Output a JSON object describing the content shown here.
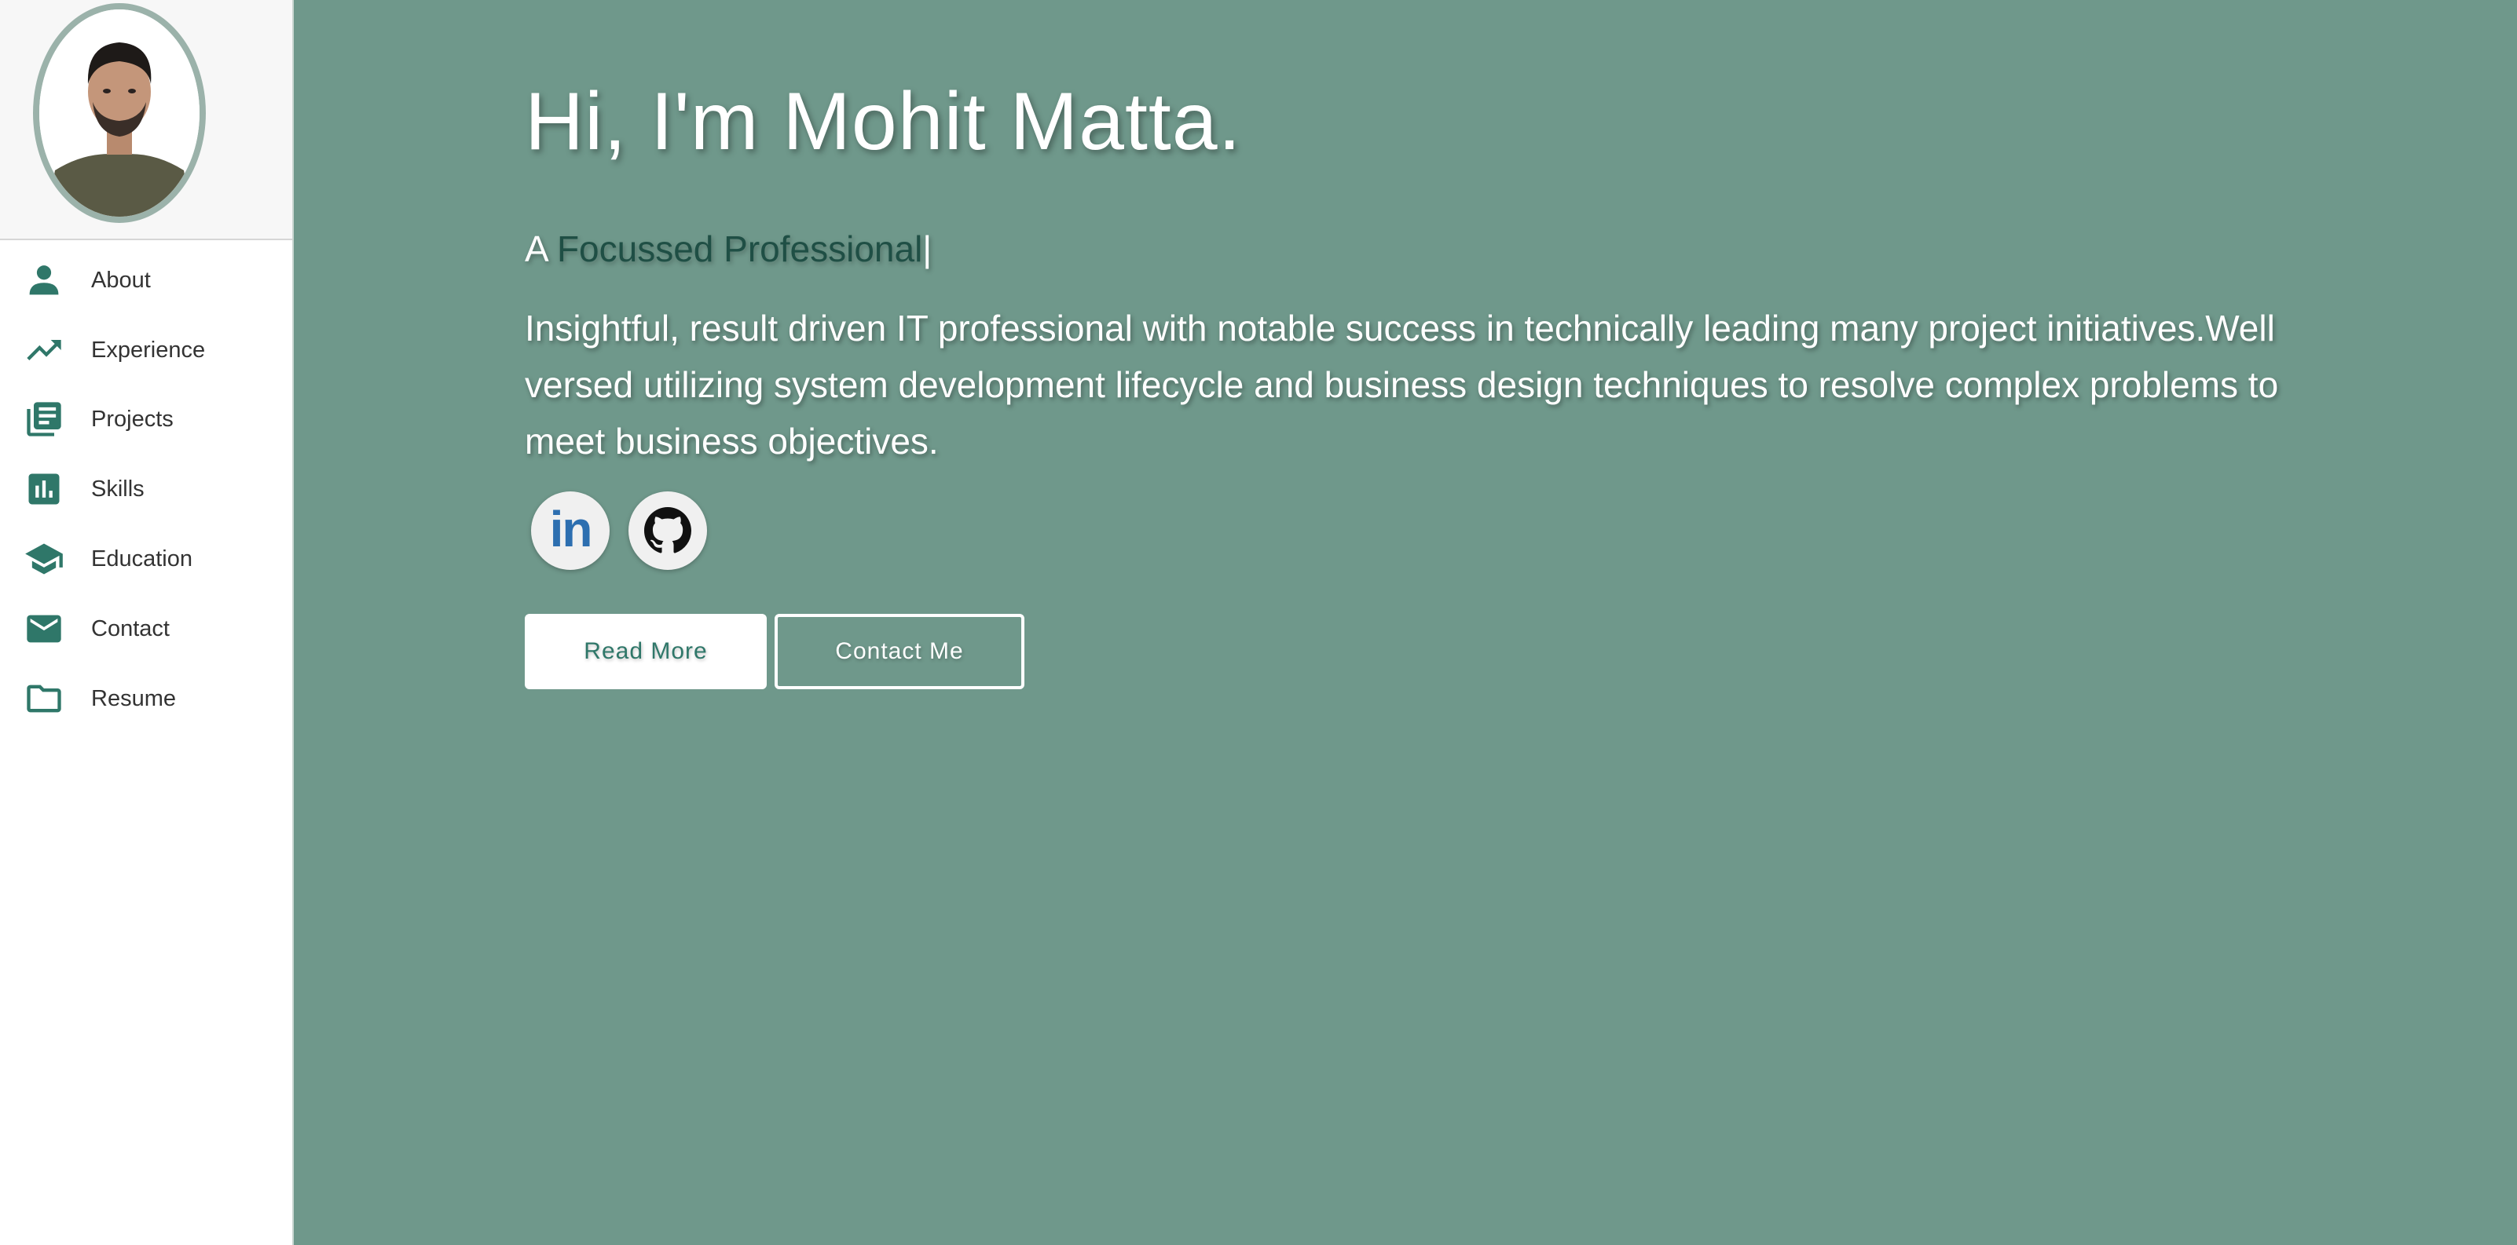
{
  "sidebar": {
    "avatar_alt": "profile photo",
    "items": [
      {
        "label": "About",
        "icon": "person-icon"
      },
      {
        "label": "Experience",
        "icon": "trending-up-icon"
      },
      {
        "label": "Projects",
        "icon": "library-books-icon"
      },
      {
        "label": "Skills",
        "icon": "bar-chart-icon"
      },
      {
        "label": "Education",
        "icon": "school-icon"
      },
      {
        "label": "Contact",
        "icon": "mail-icon"
      },
      {
        "label": "Resume",
        "icon": "folder-icon"
      }
    ]
  },
  "hero": {
    "title": "Hi, I'm Mohit Matta.",
    "subtitle_prefix": "A",
    "subtitle_typed": "Focussed Professional",
    "subtitle_cursor": "|",
    "bio": "Insightful, result driven IT professional with notable success in technically leading many project initiatives.Well versed utilizing system development lifecycle and business design techniques to resolve complex problems to meet business objectives.",
    "social": {
      "linkedin_text": "in",
      "linkedin_icon": "linkedin-icon",
      "github_icon": "github-icon"
    },
    "buttons": {
      "read_more": "Read More",
      "contact_me": "Contact Me"
    }
  },
  "colors": {
    "background": "#6f988b",
    "accent": "#2f7769",
    "sidebar": "#ffffff",
    "linkedin": "#2d6fb0"
  }
}
